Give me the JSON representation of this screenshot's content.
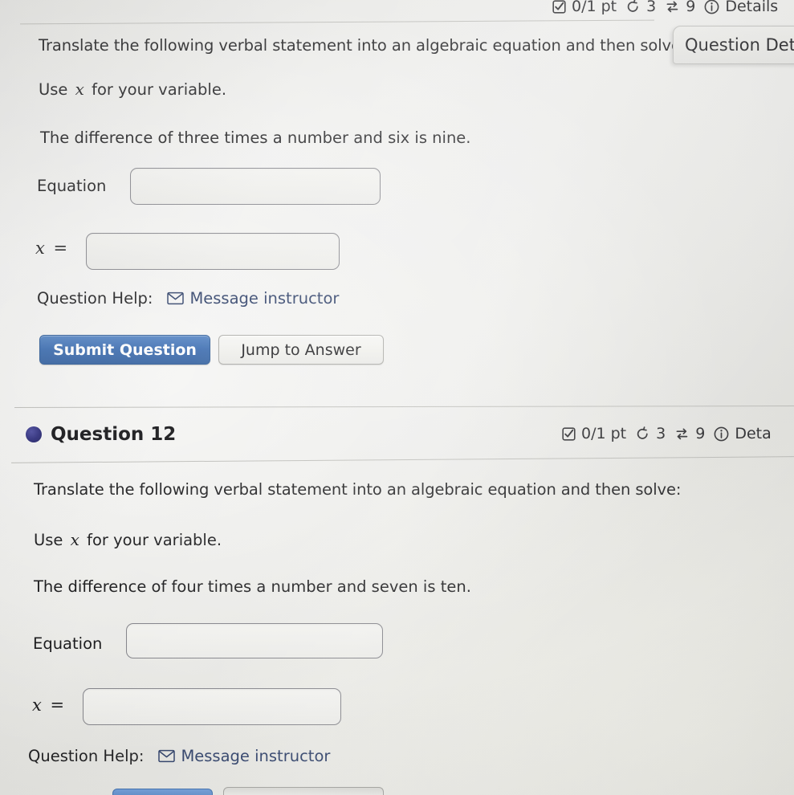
{
  "sections": [
    {
      "id": "question-11-partial",
      "meta": {
        "checkbox_icon": "checkbox-checked-icon",
        "points": "0/1 pt",
        "retry_icon": "retry-arrow-icon",
        "retry_count": "3",
        "attempts_icon": "swap-arrows-icon",
        "attempts_count": "9",
        "info_icon": "info-circle-icon",
        "details_label": "Details"
      },
      "body": {
        "line1": "Translate the following verbal statement into an algebraic equation and then solve:",
        "line2_prefix": "Use",
        "line2_var": "x",
        "line2_suffix": "for your variable.",
        "line3": "The difference of three times a number and six is nine."
      },
      "equation_label": "Equation",
      "equation_value": "",
      "equation_placeholder": "",
      "answer_label_var": "x",
      "answer_label_eq": "=",
      "answer_value": "",
      "answer_placeholder": "",
      "help": {
        "label": "Question Help:",
        "mail_icon": "envelope-icon",
        "link_label": "Message instructor"
      },
      "buttons": {
        "submit_label": "Submit Question",
        "jump_label": "Jump to Answer"
      }
    },
    {
      "id": "question-12",
      "title": "Question 12",
      "bullet_icon": "filled-circle-bullet-icon",
      "meta": {
        "checkbox_icon": "checkbox-checked-icon",
        "points": "0/1 pt",
        "retry_icon": "retry-arrow-icon",
        "retry_count": "3",
        "attempts_icon": "swap-arrows-icon",
        "attempts_count": "9",
        "info_icon": "info-circle-icon",
        "details_label": "Deta"
      },
      "body": {
        "line1": "Translate the following verbal statement into an algebraic equation and then solve:",
        "line2_prefix": "Use",
        "line2_var": "x",
        "line2_suffix": "for your variable.",
        "line3": "The difference of four times a number and seven is ten."
      },
      "equation_label": "Equation",
      "equation_value": "",
      "equation_placeholder": "",
      "answer_label_var": "x",
      "answer_label_eq": "=",
      "answer_value": "",
      "answer_placeholder": "",
      "help": {
        "label": "Question Help:",
        "mail_icon": "envelope-icon",
        "link_label": "Message instructor"
      }
    }
  ],
  "tooltip": {
    "text": "Question Detail",
    "icon": "none"
  },
  "colors": {
    "primary_button": "#3b6cb0",
    "bullet": "#2d2d7c",
    "link": "#2b3d66",
    "page_background": "#e9e9e6",
    "text": "#1d1d1f",
    "border": "#84848a"
  }
}
